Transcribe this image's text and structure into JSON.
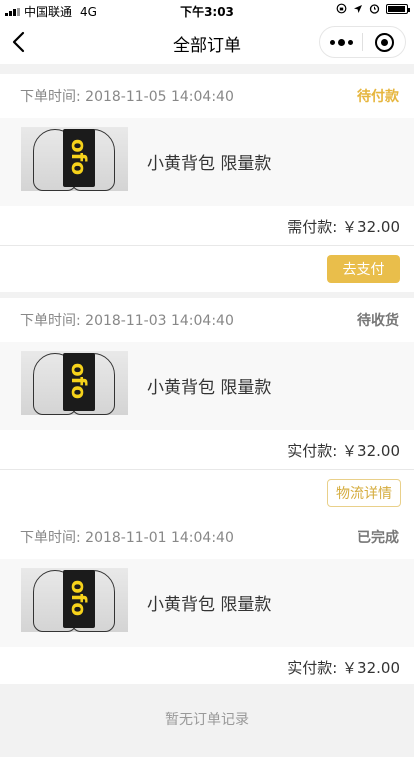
{
  "status_bar": {
    "carrier": "中国联通",
    "network": "4G",
    "time": "下午3:03",
    "battery_level": 0.95
  },
  "nav": {
    "title": "全部订单",
    "back_icon": "chevron-left-icon",
    "more_icon": "more-dots-icon",
    "close_icon": "target-close-icon"
  },
  "orders": [
    {
      "time_label": "下单时间: 2018-11-05 14:04:40",
      "status": "待付款",
      "status_color": "#e6b63e",
      "product_name": "小黄背包 限量款",
      "thumb_logo": "ofo",
      "amount": "需付款: ￥32.00",
      "action": "去支付"
    },
    {
      "time_label": "下单时间: 2018-11-03 14:04:40",
      "status": "待收货",
      "status_color": "#777777",
      "product_name": "小黄背包 限量款",
      "thumb_logo": "ofo",
      "amount": "实付款: ￥32.00",
      "action": "物流详情"
    },
    {
      "time_label": "下单时间: 2018-11-01 14:04:40",
      "status": "已完成",
      "status_color": "#777777",
      "product_name": "小黄背包 限量款",
      "thumb_logo": "ofo",
      "amount": "实付款: ￥32.00"
    }
  ],
  "empty_tip": "暂无订单记录",
  "colors": {
    "accent": "#e9be4b",
    "background": "#f2f2f2"
  }
}
